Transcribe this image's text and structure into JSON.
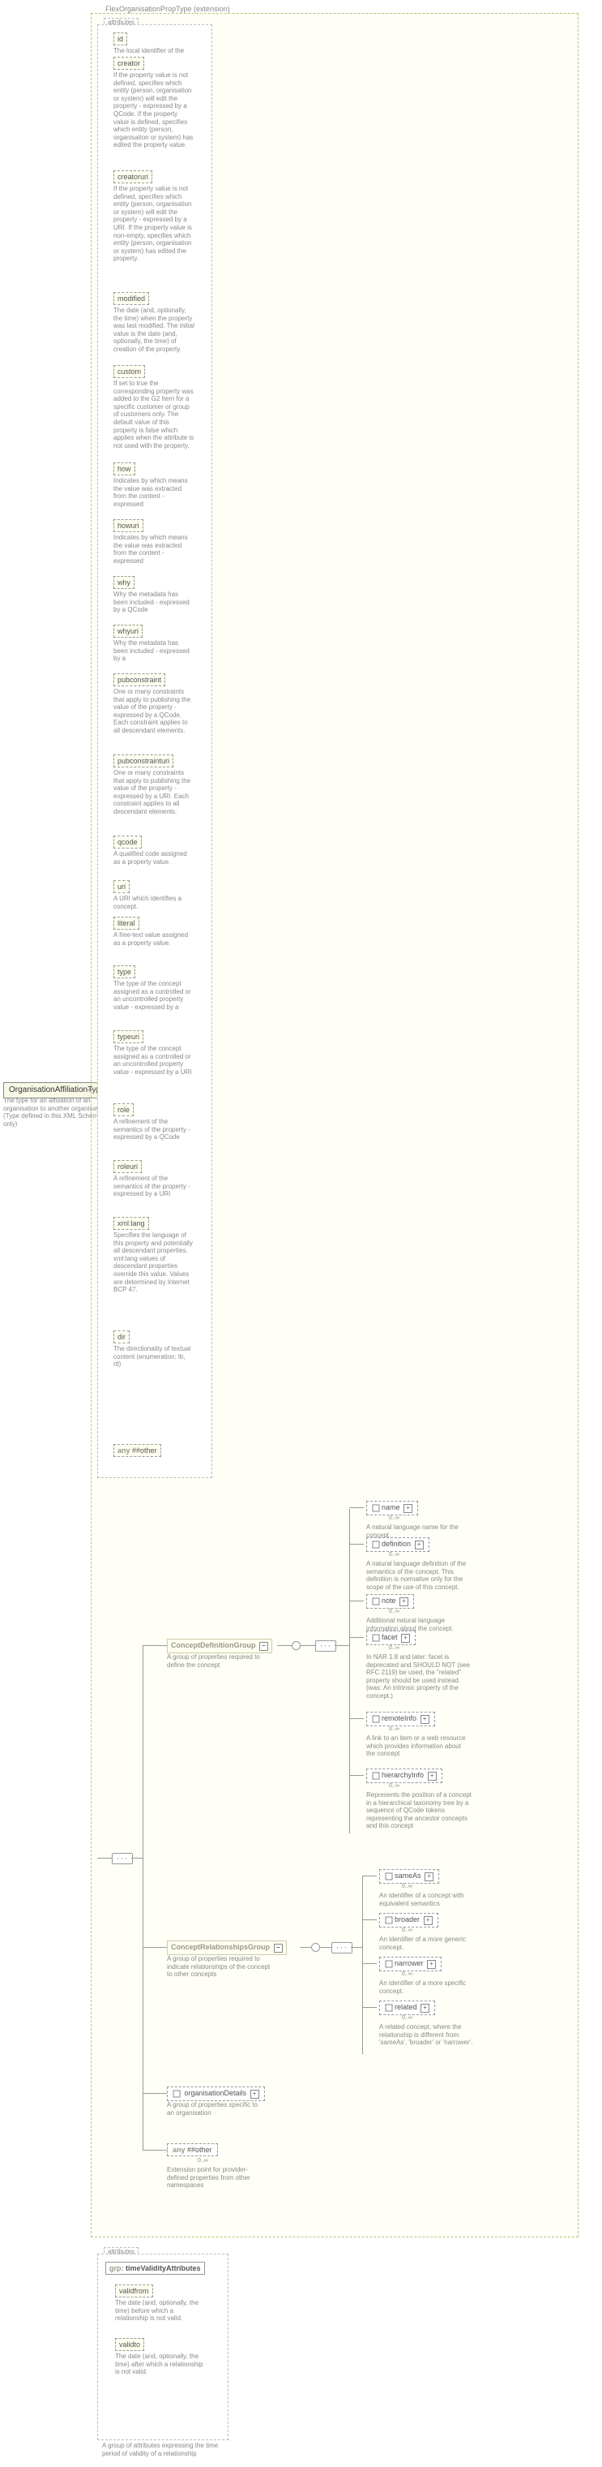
{
  "root": {
    "name": "OrganisationAffiliationType",
    "desc": "The type for an affiliation of an organisation to another organisation (Type defined in this XML Schema only)"
  },
  "container_title": "FlexOrganisationPropType (extension)",
  "attributes_label": "attributes",
  "attributes": [
    {
      "name": "id",
      "desc": "The local identifier of the"
    },
    {
      "name": "creator",
      "desc": "If the property value is not defined, specifies which entity (person, organisation or system) will edit the property - expressed by a QCode. If the property value is defined, specifies which entity (person, organisation or system) has edited the property value."
    },
    {
      "name": "creatoruri",
      "desc": "If the property value is not defined, specifies which entity (person, organisation or system) will edit the property - expressed by a URI. If the property value is non-empty, specifies which entity (person, organisation or system) has edited the property."
    },
    {
      "name": "modified",
      "desc": "The date (and, optionally, the time) when the property was last modified. The initial value is the date (and, optionally, the time) of creation of the property."
    },
    {
      "name": "custom",
      "desc": "If set to true the corresponding property was added to the G2 Item for a specific customer or group of customers only. The default value of this property is false which applies when the attribute is not used with the property."
    },
    {
      "name": "how",
      "desc": "Indicates by which means the value was extracted from the content - expressed"
    },
    {
      "name": "howuri",
      "desc": "Indicates by which means the value was extracted from the content - expressed"
    },
    {
      "name": "why",
      "desc": "Why the metadata has been included - expressed by a QCode"
    },
    {
      "name": "whyuri",
      "desc": "Why the metadata has been included - expressed by a"
    },
    {
      "name": "pubconstraint",
      "desc": "One or many constraints that apply to publishing the value of the property - expressed by a QCode. Each constraint applies to all descendant elements."
    },
    {
      "name": "pubconstrainturi",
      "desc": "One or many constraints that apply to publishing the value of the property - expressed by a URI. Each constraint applies to all descendant elements."
    },
    {
      "name": "qcode",
      "desc": "A qualified code assigned as a property value."
    },
    {
      "name": "uri",
      "desc": "A URI which identifies a concept."
    },
    {
      "name": "literal",
      "desc": "A free-text value assigned as a property value."
    },
    {
      "name": "type",
      "desc": "The type of the concept assigned as a controlled or an uncontrolled property value - expressed by a"
    },
    {
      "name": "typeuri",
      "desc": "The type of the concept assigned as a controlled or an uncontrolled property value - expressed by a URI"
    },
    {
      "name": "role",
      "desc": "A refinement of the semantics of the property - expressed by a QCode"
    },
    {
      "name": "roleuri",
      "desc": "A refinement of the semantics of the property - expressed by a URI"
    },
    {
      "name": "xml:lang",
      "desc": "Specifies the language of this property and potentially all descendant properties. xml:lang values of descendant properties override this value. Values are determined by Internet BCP 47."
    },
    {
      "name": "dir",
      "desc": "The directionality of textual content (enumeration: ltr, rtl)"
    },
    {
      "name_prefix": "any",
      "name": "##other"
    }
  ],
  "groups": {
    "def": {
      "name": "ConceptDefinitionGroup",
      "desc": "A group of properties required to define the concept"
    },
    "rel": {
      "name": "ConceptRelationshipsGroup",
      "desc": "A group of properties required to indicate relationships of the concept to other concepts"
    }
  },
  "def_items": [
    {
      "name": "name",
      "desc": "A natural language name for the concept."
    },
    {
      "name": "definition",
      "desc": "A natural language definition of the semantics of the concept. This definition is normative only for the scope of the use of this concept."
    },
    {
      "name": "note",
      "desc": "Additional natural language information about the concept."
    },
    {
      "name": "facet",
      "desc": "In NAR 1.8 and later: facet is deprecated and SHOULD NOT (see RFC 2119) be used, the \"related\" property should be used instead. (was: An intrinsic property of the concept.)"
    },
    {
      "name": "remoteInfo",
      "desc": "A link to an item or a web resource which provides information about the concept"
    },
    {
      "name": "hierarchyInfo",
      "desc": "Represents the position of a concept in a hierarchical taxonomy tree by a sequence of QCode tokens representing the ancestor concepts and this concept"
    }
  ],
  "rel_items": [
    {
      "name": "sameAs",
      "desc": "An identifier of a concept with equivalent semantics"
    },
    {
      "name": "broader",
      "desc": "An identifier of a more generic concept."
    },
    {
      "name": "narrower",
      "desc": "An identifier of a more specific concept."
    },
    {
      "name": "related",
      "desc": "A related concept, where the relationship is different from 'sameAs', 'broader' or 'narrower'."
    }
  ],
  "org_details": {
    "name": "organisationDetails",
    "desc": "A group of properties specific to an organisation"
  },
  "any_other": {
    "prefix": "any",
    "name": "##other",
    "card": "0..∞",
    "desc": "Extension point for provider-defined properties from other namespaces"
  },
  "validity": {
    "group_prefix": "grp:",
    "group_name": "timeValidityAttributes",
    "attrs": [
      {
        "name": "validfrom",
        "desc": "The date (and, optionally, the time) before which a relationship is not valid."
      },
      {
        "name": "validto",
        "desc": "The date (and, optionally, the time) after which a relationship is not valid."
      }
    ],
    "desc": "A group of attributes expressing the time period of validity of a relationship"
  },
  "card_0inf": "0..∞"
}
